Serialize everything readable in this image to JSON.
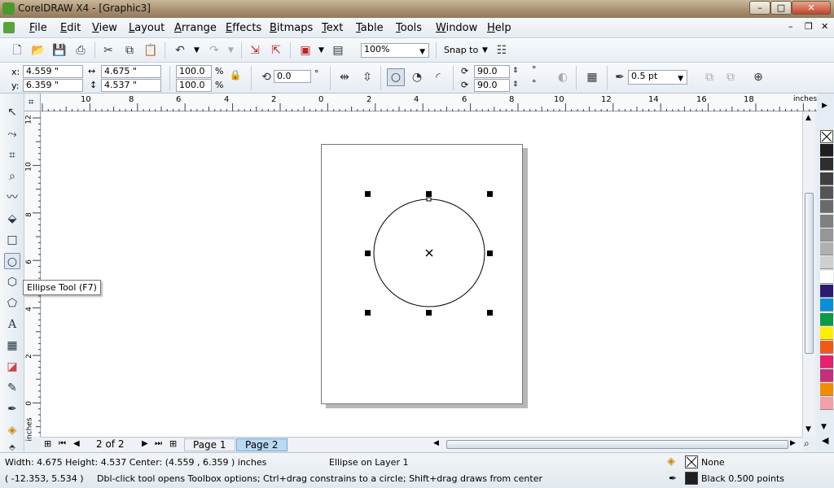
{
  "window": {
    "title": "CorelDRAW X4 - [Graphic3]",
    "minimize": "–",
    "maximize": "□",
    "close": "✕",
    "doc_minimize": "–",
    "doc_restore": "❐",
    "doc_close": "✕"
  },
  "menu": [
    "File",
    "Edit",
    "View",
    "Layout",
    "Arrange",
    "Effects",
    "Bitmaps",
    "Text",
    "Table",
    "Tools",
    "Window",
    "Help"
  ],
  "standard_toolbar": {
    "zoom_value": "100%",
    "snap_to_label": "Snap to"
  },
  "property_bar": {
    "x_label": "x:",
    "x_value": "4.559 \"",
    "y_label": "y:",
    "y_value": "6.359 \"",
    "width_value": "4.675 \"",
    "height_value": "4.537 \"",
    "scale_x": "100.0",
    "scale_y": "100.0",
    "percent": "%",
    "rotation_value": "0.0",
    "degree": "°",
    "start_angle": "90.0",
    "end_angle": "90.0",
    "outline_width": "0.5 pt"
  },
  "rulers": {
    "unit": "inches",
    "h_ticks": [
      "10",
      "8",
      "6",
      "4",
      "2",
      "0",
      "2",
      "4",
      "6",
      "8",
      "10",
      "12",
      "14",
      "16",
      "18"
    ],
    "v_ticks": [
      "12",
      "10",
      "8",
      "6",
      "4",
      "2",
      "0"
    ]
  },
  "tooltip": "Ellipse Tool (F7)",
  "page_nav": {
    "counter": "2 of 2",
    "pages": [
      "Page 1",
      "Page 2"
    ],
    "active_page": "Page 2"
  },
  "status": {
    "dimensions": "Width: 4.675  Height: 4.537  Center: (4.559 , 6.359 )  inches",
    "object": "Ellipse on Layer 1",
    "cursor": "( -12.353, 5.534 )",
    "hint": "Dbl-click tool opens Toolbox options; Ctrl+drag constrains to a circle; Shift+drag draws from center",
    "fill": "None",
    "outline": "Black  0.500 points"
  },
  "palette_colors": [
    "#1e1e1e",
    "#2e2e2e",
    "#404040",
    "#555555",
    "#6a6a6a",
    "#808080",
    "#969696",
    "#b0b0b0",
    "#cfcfcf",
    "#ffffff",
    "#2b1a6e",
    "#0a8fd8",
    "#0b9a45",
    "#ffee00",
    "#f05a14",
    "#e8206e",
    "#c4307a",
    "#f08c00",
    "#f4a0a8"
  ],
  "icons": {
    "app": "corel-balloon-icon",
    "fill_indicator": "no-fill-icon",
    "outline_indicator": "black-outline-icon"
  }
}
